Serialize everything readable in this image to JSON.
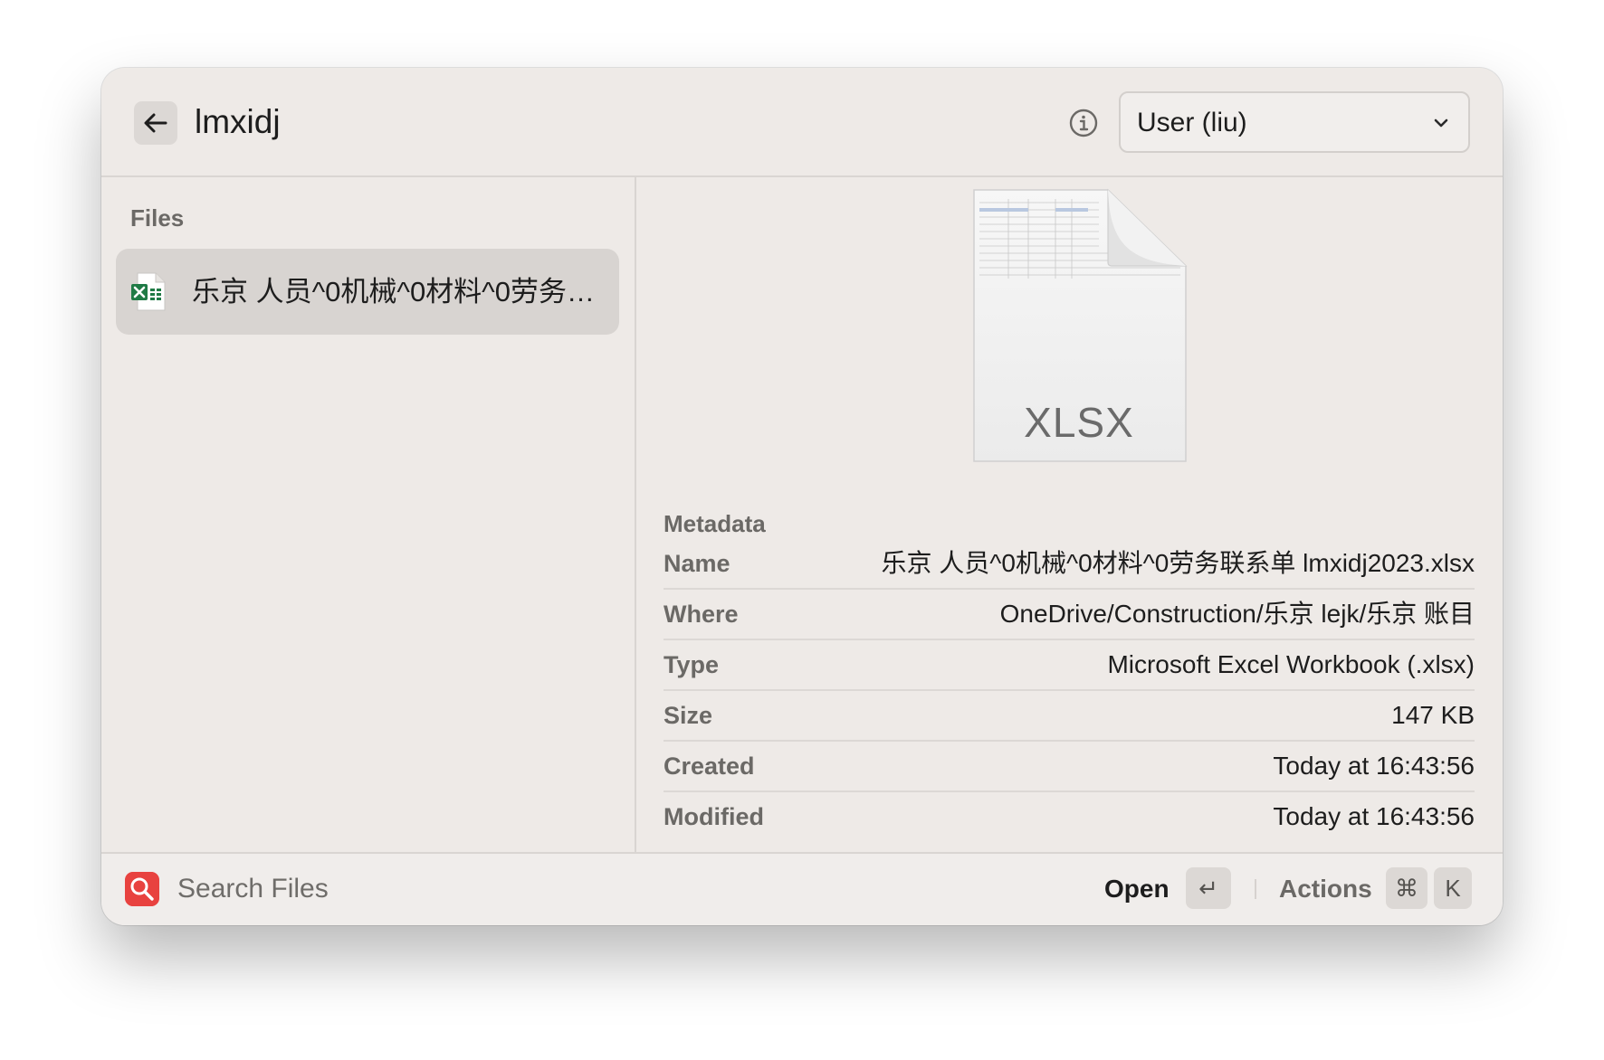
{
  "header": {
    "title": "lmxidj",
    "dropdown_value": "User (liu)"
  },
  "sidebar": {
    "section_label": "Files",
    "items": [
      {
        "label": "乐京 人员^0机械^0材料^0劳务联系单 lmxidj2023.xlsx",
        "icon": "excel-file-icon",
        "selected": true
      }
    ]
  },
  "preview": {
    "thumbnail_ext": "XLSX",
    "metadata_label": "Metadata",
    "metadata": [
      {
        "key": "Name",
        "value": "乐京 人员^0机械^0材料^0劳务联系单 lmxidj2023.xlsx"
      },
      {
        "key": "Where",
        "value": "OneDrive/Construction/乐京 lejk/乐京 账目"
      },
      {
        "key": "Type",
        "value": "Microsoft Excel Workbook (.xlsx)"
      },
      {
        "key": "Size",
        "value": "147 KB"
      },
      {
        "key": "Created",
        "value": "Today at 16:43:56"
      },
      {
        "key": "Modified",
        "value": "Today at 16:43:56"
      }
    ]
  },
  "footer": {
    "search_placeholder": "Search Files",
    "open_label": "Open",
    "open_key": "↵",
    "actions_label": "Actions",
    "actions_key_mod": "⌘",
    "actions_key": "K"
  },
  "colors": {
    "window_bg": "#eeeae7",
    "selected_bg": "#d8d4d1",
    "search_icon_bg": "#e8423f",
    "excel_green": "#1f7a45"
  }
}
